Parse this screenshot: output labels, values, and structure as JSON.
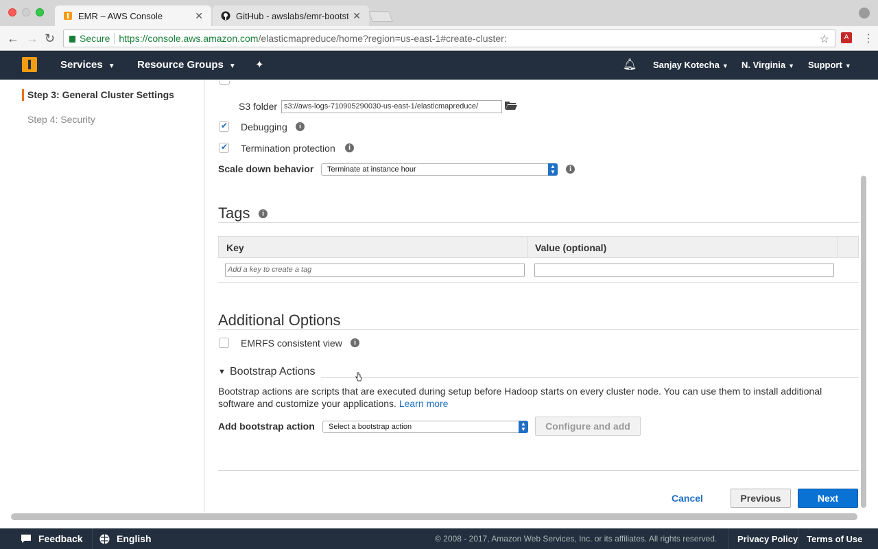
{
  "browser": {
    "tabs": [
      {
        "title": "EMR – AWS Console",
        "active": true
      },
      {
        "title": "GitHub - awslabs/emr-bootstra",
        "active": false
      }
    ],
    "secure_label": "Secure",
    "url_scheme_host": "https://console.aws.amazon.com",
    "url_path": "/elasticmapreduce/home?region=us-east-1#create-cluster:"
  },
  "aws_header": {
    "services": "Services",
    "resource_groups": "Resource Groups",
    "user": "Sanjay Kotecha",
    "region": "N. Virginia",
    "support": "Support"
  },
  "wizard_nav": {
    "steps": [
      {
        "label": "Step 3: General Cluster Settings",
        "active": true
      },
      {
        "label": "Step 4: Security",
        "active": false
      }
    ]
  },
  "general": {
    "s3_folder_label": "S3 folder",
    "s3_folder_value": "s3://aws-logs-710905290030-us-east-1/elasticmapreduce/",
    "debugging_label": "Debugging",
    "debugging_checked": true,
    "termination_label": "Termination protection",
    "termination_checked": true,
    "scale_down_label": "Scale down behavior",
    "scale_down_value": "Terminate at instance hour"
  },
  "tags": {
    "title": "Tags",
    "col_key": "Key",
    "col_value": "Value (optional)",
    "key_placeholder": "Add a key to create a tag"
  },
  "additional": {
    "title": "Additional Options",
    "emrfs_label": "EMRFS consistent view",
    "bootstrap_title": "Bootstrap Actions",
    "bootstrap_desc": "Bootstrap actions are scripts that are executed during setup before Hadoop starts on every cluster node. You can use them to install additional software and customize your applications.",
    "learn_more": "Learn more",
    "add_bootstrap_label": "Add bootstrap action",
    "bootstrap_select": "Select a bootstrap action",
    "configure_add": "Configure and add"
  },
  "actions": {
    "cancel": "Cancel",
    "previous": "Previous",
    "next": "Next"
  },
  "footer": {
    "feedback": "Feedback",
    "language": "English",
    "copyright": "© 2008 - 2017, Amazon Web Services, Inc. or its affiliates. All rights reserved.",
    "privacy": "Privacy Policy",
    "terms": "Terms of Use"
  }
}
